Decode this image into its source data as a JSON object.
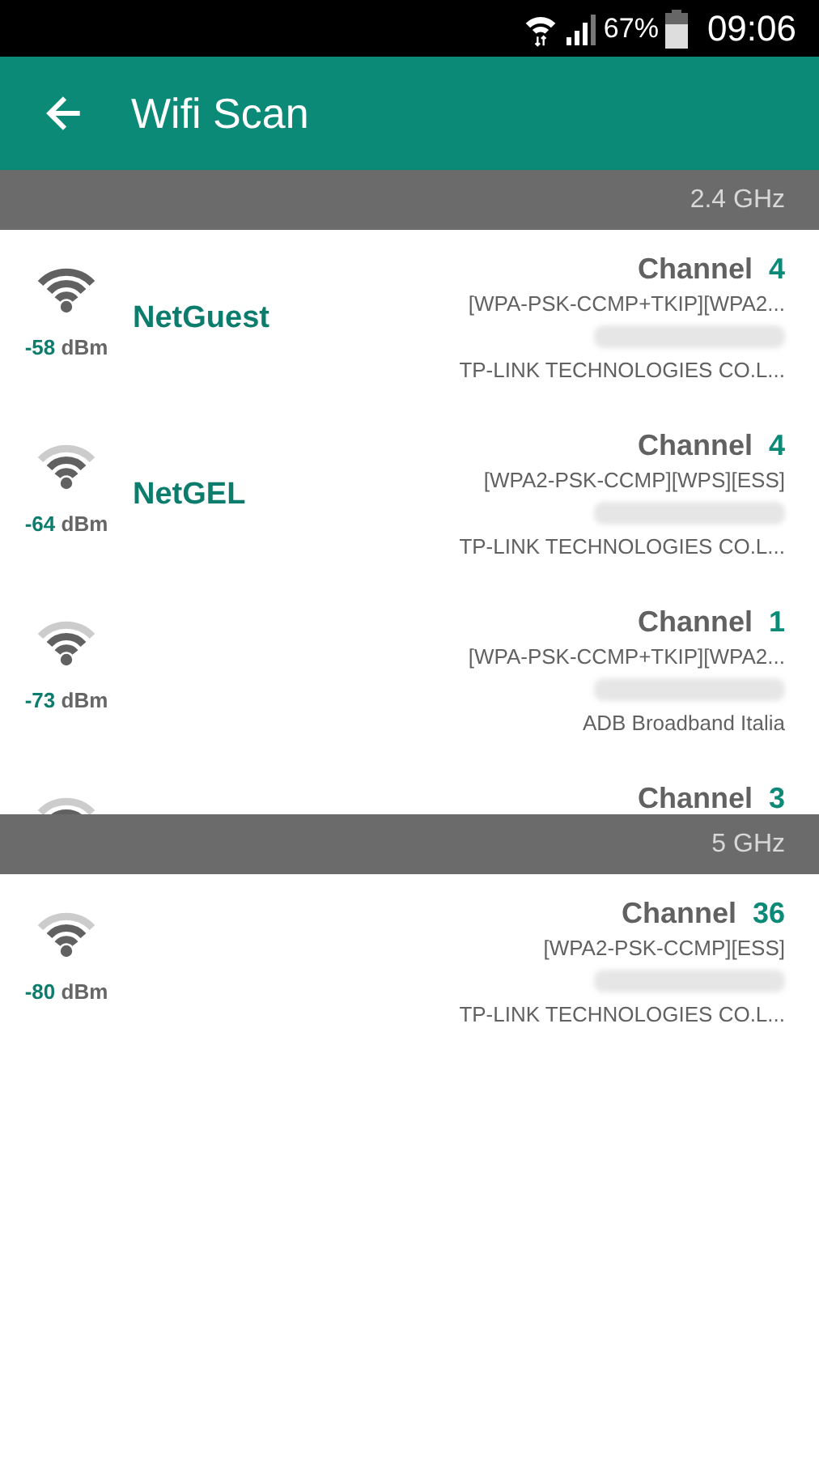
{
  "status_bar": {
    "battery": "67%",
    "time": "09:06"
  },
  "app_bar": {
    "title": "Wifi Scan"
  },
  "sections": [
    {
      "band": "2.4 GHz",
      "networks": [
        {
          "name": "NetGuest",
          "signal": "-58",
          "unit": "dBm",
          "strong": true,
          "channel_label": "Channel",
          "channel": "4",
          "security": "[WPA-PSK-CCMP+TKIP][WPA2...",
          "vendor": "TP-LINK TECHNOLOGIES CO.L..."
        },
        {
          "name": "NetGEL",
          "signal": "-64",
          "unit": "dBm",
          "strong": false,
          "channel_label": "Channel",
          "channel": "4",
          "security": "[WPA2-PSK-CCMP][WPS][ESS]",
          "vendor": "TP-LINK TECHNOLOGIES CO.L..."
        },
        {
          "signal": "-73",
          "unit": "dBm",
          "strong": false,
          "channel_label": "Channel",
          "channel": "1",
          "security": "[WPA-PSK-CCMP+TKIP][WPA2...",
          "vendor": "ADB Broadband Italia"
        },
        {
          "strong": false,
          "channel_label": "Channel",
          "channel": "3"
        }
      ]
    },
    {
      "band": "5 GHz",
      "networks": [
        {
          "signal": "-80",
          "unit": "dBm",
          "strong": false,
          "channel_label": "Channel",
          "channel": "36",
          "security": "[WPA2-PSK-CCMP][ESS]",
          "vendor": "TP-LINK TECHNOLOGIES CO.L..."
        }
      ]
    }
  ]
}
